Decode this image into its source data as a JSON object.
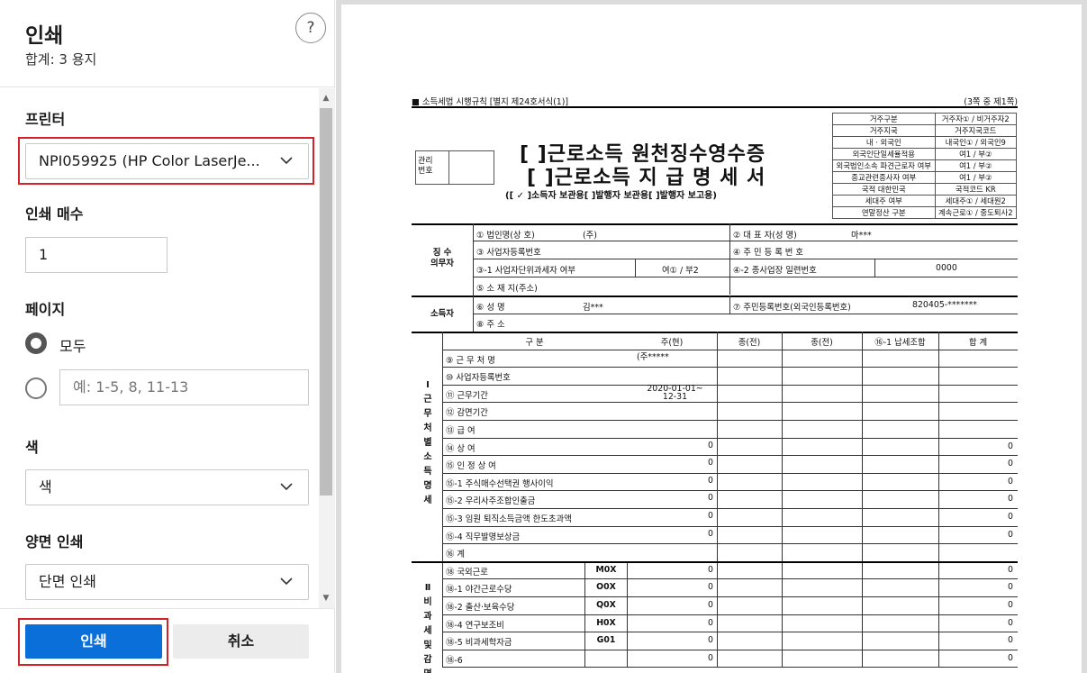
{
  "dialog": {
    "title": "인쇄",
    "subtitle": "합계: 3 용지",
    "help_glyph": "?"
  },
  "printer": {
    "label": "프린터",
    "selected": "NPI059925 (HP Color LaserJe..."
  },
  "copies": {
    "label": "인쇄 매수",
    "value": "1"
  },
  "pages": {
    "label": "페이지",
    "all_label": "모두",
    "custom_placeholder": "예: 1-5, 8, 11-13"
  },
  "color": {
    "label": "색",
    "selected": "색"
  },
  "duplex": {
    "label": "양면 인쇄",
    "selected": "단면 인쇄"
  },
  "buttons": {
    "print": "인쇄",
    "cancel": "취소"
  },
  "accent": {
    "primary_blue": "#0a6fd8",
    "highlight_red": "#d2232a"
  },
  "doc": {
    "header_left": "■ 소득세법 시행규칙 [별지 제24호서식(1)]",
    "header_right": "(3쪽 중 제1쪽)",
    "mgmt_no": "관리\n번호",
    "title1": "[  ]근로소득 원천징수영수증",
    "title2": "[  ]근로소득 지 급 명 세 서",
    "title3": "([  ✓  ]소득자 보관용[        ]발행자 보관용[        ]발행자 보고용)",
    "info_rows": [
      [
        "거주구분",
        "거주자① / 비거주자2"
      ],
      [
        "거주지국",
        "거주지국코드"
      ],
      [
        "내 · 외국인",
        "내국인① / 외국인9"
      ],
      [
        "외국인단일세율적용",
        "여1 / 부②"
      ],
      [
        "외국법인소속 파견근로자 여부",
        "여1 / 부②"
      ],
      [
        "종교관련종사자 여부",
        "여1 / 부②"
      ],
      [
        "국적  대한민국",
        "국적코드  KR"
      ],
      [
        "세대주 여부",
        "세대주① / 세대원2"
      ],
      [
        "연말정산 구분",
        "계속근로① / 중도퇴사2"
      ]
    ],
    "payer_section": "징 수\n의무자",
    "payer": {
      "corp_label": "① 법인명(상  호)",
      "corp_value": "(주)",
      "rep_label": "② 대 표 자(성   명)",
      "rep_value": "마***",
      "bizno_label": "③ 사업자등록번호",
      "resno_label": "④ 주 민 등 록 번 호",
      "unit_label": "③-1 사업자단위과세자 여부",
      "unit_value": "여① / 부2",
      "branch_label": "④-2 종사업장 일련번호",
      "branch_value": "0000",
      "addr_label": "⑤ 소 재 지(주소)"
    },
    "earner_section": "소득자",
    "earner": {
      "name_label": "⑥ 성          명",
      "name_value": "김***",
      "id_label": "⑦ 주민등록번호(외국인등록번호)",
      "id_value": "820405-*******",
      "addr_label": "⑧ 주          소"
    },
    "columns": [
      "구  분",
      "주(현)",
      "종(전)",
      "종(전)",
      "⑯-1 납세조합",
      "합  계"
    ],
    "section1_title": "Ⅰ근무처별소득명세",
    "section1_rows": [
      {
        "label": "⑨ 근 무 처 명",
        "cur": "(주*****",
        "total": ""
      },
      {
        "label": "⑩ 사업자등록번호",
        "cur": "",
        "total": ""
      },
      {
        "label": "⑪ 근무기간",
        "cur": "2020-01-01~\n12-31",
        "total": ""
      },
      {
        "label": "⑫ 감면기간",
        "cur": "",
        "total": ""
      },
      {
        "label": "⑬ 급        여",
        "cur": "",
        "total": ""
      },
      {
        "label": "⑭ 상        여",
        "cur": "0",
        "total": "0"
      },
      {
        "label": "⑮ 인 정 상 여",
        "cur": "0",
        "total": "0"
      },
      {
        "label": "⑮-1 주식매수선택권 행사이익",
        "cur": "0",
        "total": "0"
      },
      {
        "label": "⑮-2 우리사주조합인출금",
        "cur": "0",
        "total": "0"
      },
      {
        "label": "⑮-3 임원 퇴직소득금액 한도초과액",
        "cur": "0",
        "total": "0"
      },
      {
        "label": "⑮-4 직무발명보상금",
        "cur": "0",
        "total": "0"
      },
      {
        "label": "⑯ 계",
        "cur": "",
        "total": ""
      }
    ],
    "section2_title": "Ⅱ비과세및감면",
    "section2_rows": [
      {
        "label": "⑱ 국외근로",
        "code": "M0X",
        "cur": "0",
        "total": "0"
      },
      {
        "label": "⑱-1 야간근로수당",
        "code": "O0X",
        "cur": "0",
        "total": "0"
      },
      {
        "label": "⑱-2 출산·보육수당",
        "code": "Q0X",
        "cur": "0",
        "total": "0"
      },
      {
        "label": "⑱-4 연구보조비",
        "code": "H0X",
        "cur": "0",
        "total": "0"
      },
      {
        "label": "⑱-5 비과세학자금",
        "code": "G01",
        "cur": "0",
        "total": "0"
      },
      {
        "label": "⑱-6",
        "code": "",
        "cur": "0",
        "total": "0"
      }
    ]
  }
}
